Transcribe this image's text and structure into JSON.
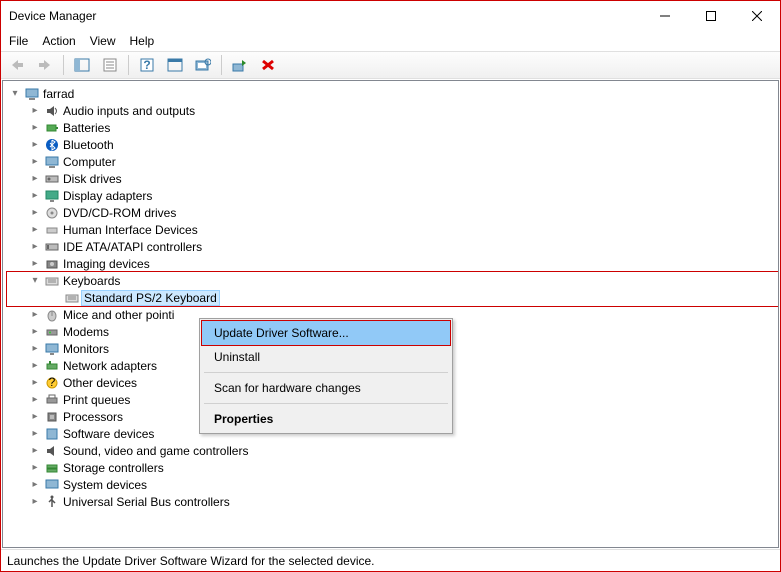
{
  "window": {
    "title": "Device Manager"
  },
  "menubar": [
    "File",
    "Action",
    "View",
    "Help"
  ],
  "tree": {
    "root": "farrad",
    "items": [
      "Audio inputs and outputs",
      "Batteries",
      "Bluetooth",
      "Computer",
      "Disk drives",
      "Display adapters",
      "DVD/CD-ROM drives",
      "Human Interface Devices",
      "IDE ATA/ATAPI controllers",
      "Imaging devices",
      "Keyboards",
      "Mice and other pointing devices",
      "Modems",
      "Monitors",
      "Network adapters",
      "Other devices",
      "Print queues",
      "Processors",
      "Software devices",
      "Sound, video and game controllers",
      "Storage controllers",
      "System devices",
      "Universal Serial Bus controllers"
    ],
    "keyboards_child": "Standard PS/2 Keyboard"
  },
  "context_menu": {
    "update": "Update Driver Software...",
    "uninstall": "Uninstall",
    "scan": "Scan for hardware changes",
    "properties": "Properties"
  },
  "statusbar": "Launches the Update Driver Software Wizard for the selected device."
}
